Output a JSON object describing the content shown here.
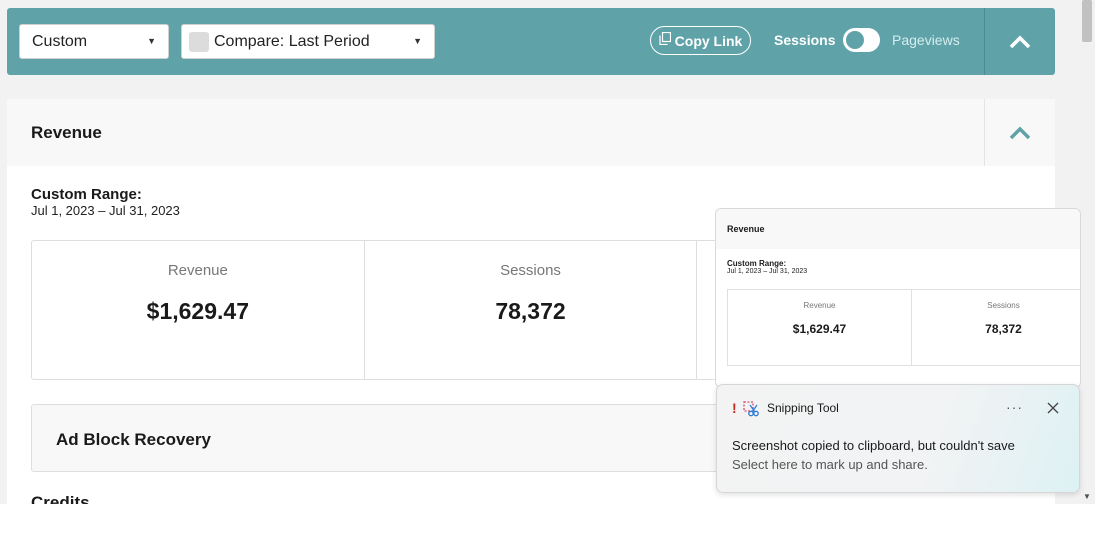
{
  "toolbar": {
    "date_preset": "Custom",
    "compare_label": "Compare: Last Period",
    "copy_link_label": "Copy Link",
    "toggle_left_label": "Sessions",
    "toggle_right_label": "Pageviews",
    "accent_color": "#5fa3a9"
  },
  "revenue": {
    "title": "Revenue",
    "range_label": "Custom Range:",
    "range_value": "Jul 1, 2023 – Jul 31, 2023",
    "stats": [
      {
        "label": "Revenue",
        "value": "$1,629.47"
      },
      {
        "label": "Sessions",
        "value": "78,372"
      }
    ]
  },
  "sections": {
    "ad_block_title": "Ad Block Recovery",
    "credits_title": "Credits"
  },
  "preview": {
    "title": "Revenue",
    "range_label": "Custom Range:",
    "range_value": "Jul 1, 2023 – Jul 31, 2023",
    "stats": [
      {
        "label": "Revenue",
        "value": "$1,629.47"
      },
      {
        "label": "Sessions",
        "value": "78,372"
      }
    ]
  },
  "toast": {
    "warning_glyph": "!",
    "app_name": "Snipping Tool",
    "more_label": "···",
    "message": "Screenshot copied to clipboard, but couldn't save",
    "sub_message": "Select here to mark up and share.",
    "warning_color": "#c42b1c"
  },
  "icons": {
    "copy": "copy-icon",
    "collapse": "chevron-up-icon",
    "dropdown": "caret-down-icon",
    "close": "close-icon",
    "app": "snipping-tool-icon"
  }
}
